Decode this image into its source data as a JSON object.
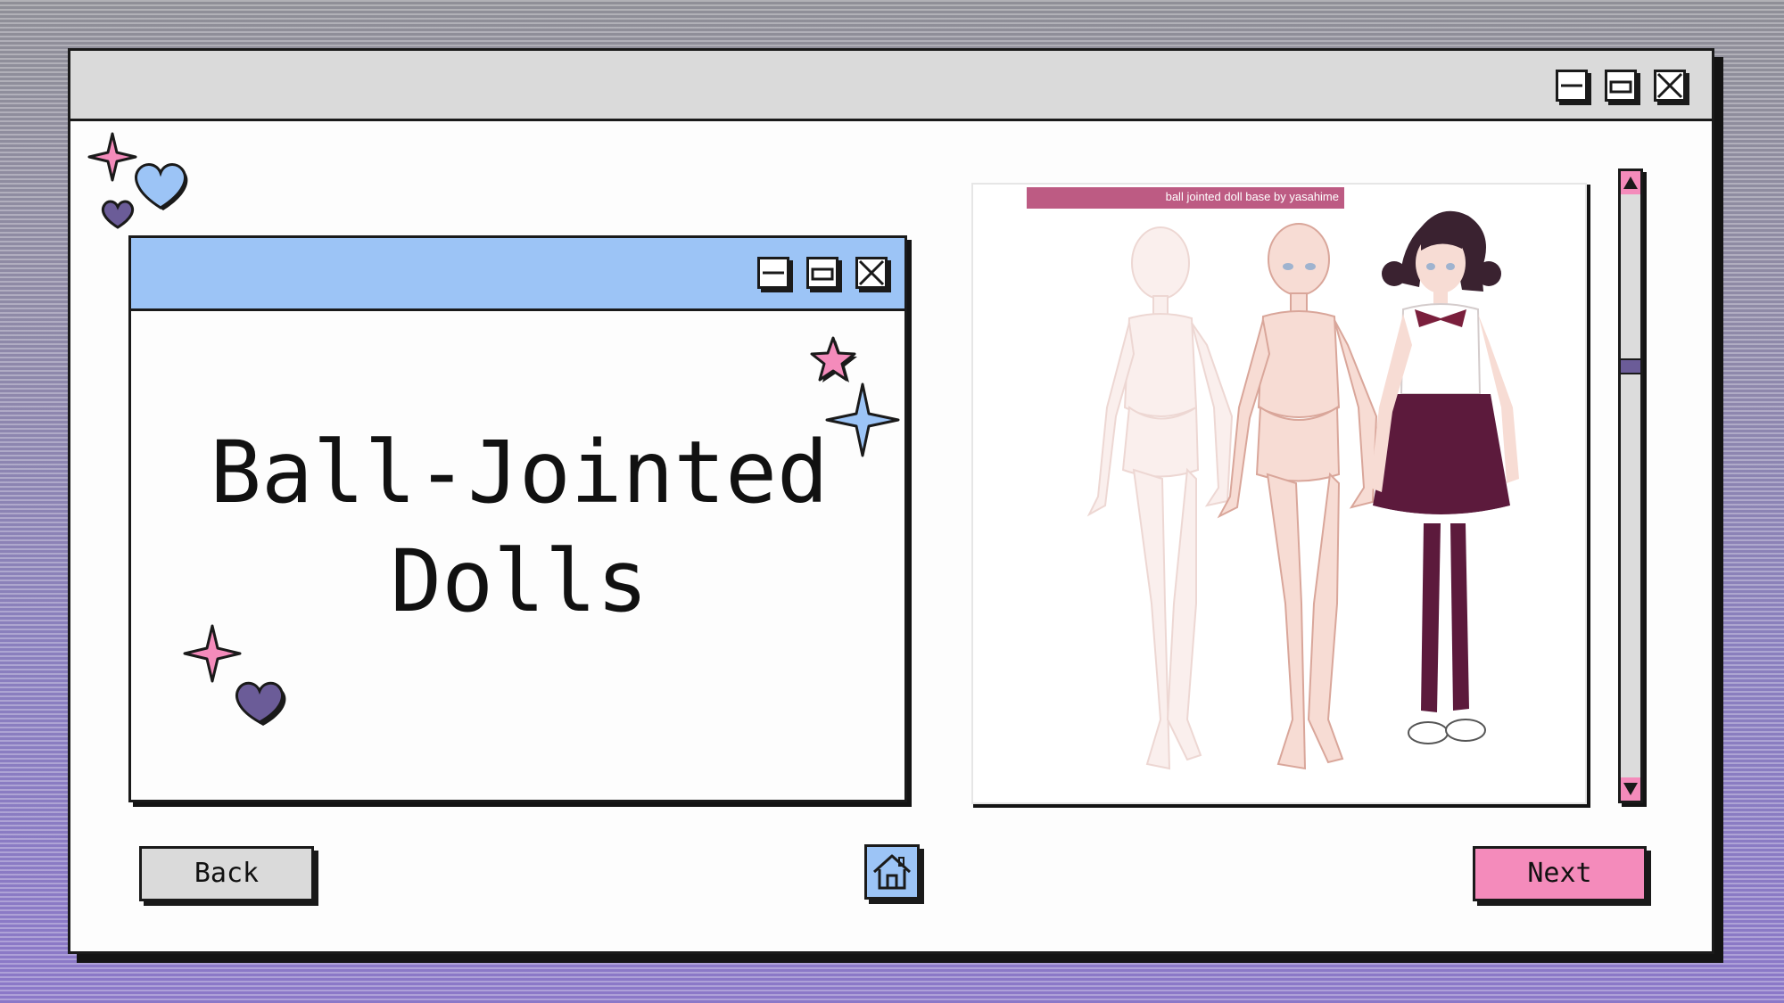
{
  "main_window": {
    "controls": [
      "minimize-icon",
      "maximize-icon",
      "close-icon"
    ]
  },
  "inner_window": {
    "controls": [
      "minimize-icon",
      "maximize-icon",
      "close-icon"
    ],
    "title_line1": "Ball-Jointed",
    "title_line2": "Dolls"
  },
  "image": {
    "caption": "ball jointed doll base by yasahime"
  },
  "nav": {
    "back_label": "Back",
    "next_label": "Next",
    "home_icon": "home-icon"
  },
  "scrollbar": {
    "up_icon": "arrow-up-icon",
    "down_icon": "arrow-down-icon"
  },
  "colors": {
    "accent_pink": "#f48bbb",
    "accent_blue": "#9cc4f6",
    "accent_purple": "#6b5c98",
    "caption_pink": "#bd5b83"
  }
}
